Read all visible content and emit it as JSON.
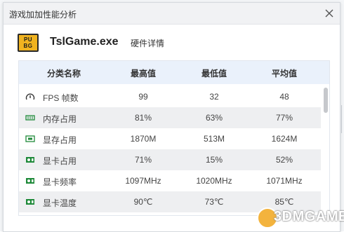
{
  "window": {
    "title": "游戏加加性能分析",
    "close_icon": "close-icon"
  },
  "game": {
    "logo_text": "PUBG",
    "exe_name": "TslGame.exe",
    "hardware_link": "硬件详情"
  },
  "table": {
    "headers": [
      "分类名称",
      "最高值",
      "最低值",
      "平均值"
    ],
    "rows": [
      {
        "icon": "gauge-icon",
        "name": "FPS 帧数",
        "max": "99",
        "min": "32",
        "avg": "48"
      },
      {
        "icon": "memory-icon",
        "name": "内存占用",
        "max": "81%",
        "min": "63%",
        "avg": "77%"
      },
      {
        "icon": "vram-icon",
        "name": "显存占用",
        "max": "1870M",
        "min": "513M",
        "avg": "1624M"
      },
      {
        "icon": "gpu-card-icon",
        "name": "显卡占用",
        "max": "71%",
        "min": "15%",
        "avg": "52%"
      },
      {
        "icon": "gpu-card-icon",
        "name": "显卡频率",
        "max": "1097MHz",
        "min": "1020MHz",
        "avg": "1071MHz"
      },
      {
        "icon": "gpu-card-icon",
        "name": "显卡温度",
        "max": "90℃",
        "min": "73℃",
        "avg": "85℃"
      }
    ]
  },
  "watermark": {
    "text": "3DMGAME"
  },
  "colors": {
    "header_bg": "#eaf1fb",
    "row_alt": "#eeeff1",
    "icon_green": "#1f8a3a"
  }
}
